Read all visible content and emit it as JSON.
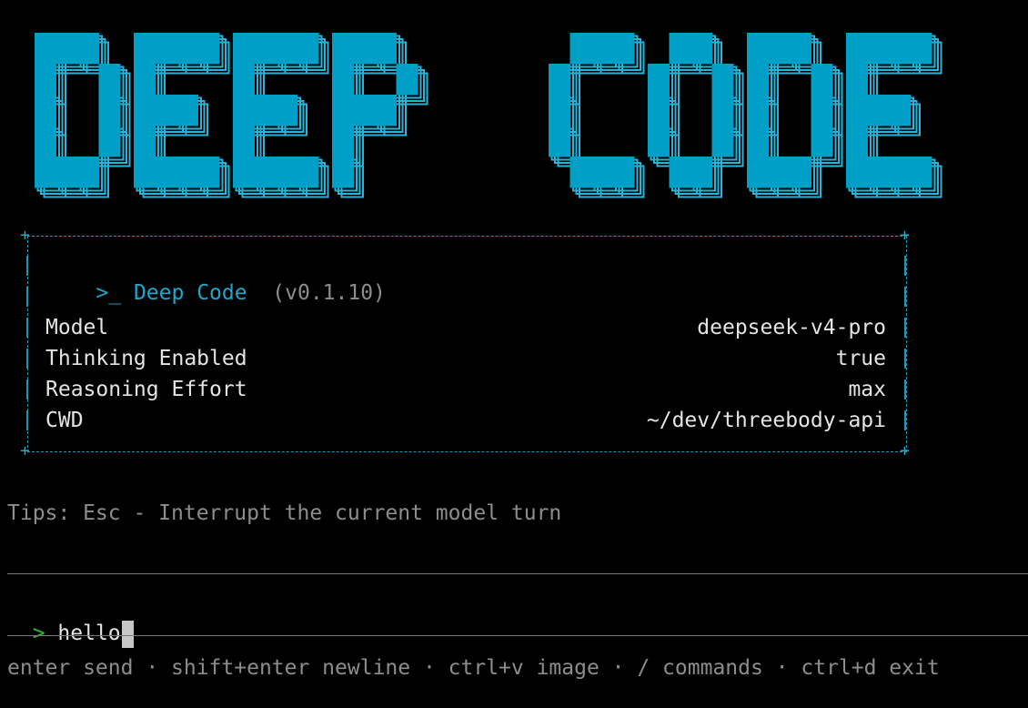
{
  "banner": {
    "text": "DEEP CODE",
    "color": "#009fc7",
    "outline_color": "#2ab3d6"
  },
  "header": {
    "prompt_symbol": ">_",
    "app_name": "Deep Code",
    "version": "(v0.1.10)"
  },
  "info": [
    {
      "label": "Model",
      "value": "deepseek-v4-pro"
    },
    {
      "label": "Thinking Enabled",
      "value": "true"
    },
    {
      "label": "Reasoning Effort",
      "value": "max"
    },
    {
      "label": "CWD",
      "value": "~/dev/threebody-api"
    }
  ],
  "tips": "Tips: Esc - Interrupt the current model turn",
  "input": {
    "prompt": ">",
    "value": "hello"
  },
  "footer": "enter send · shift+enter newline · ctrl+v image · / commands · ctrl+d exit",
  "colors": {
    "accent": "#1da7cc",
    "prompt": "#2fb62f",
    "dim": "#8d8d8d"
  }
}
